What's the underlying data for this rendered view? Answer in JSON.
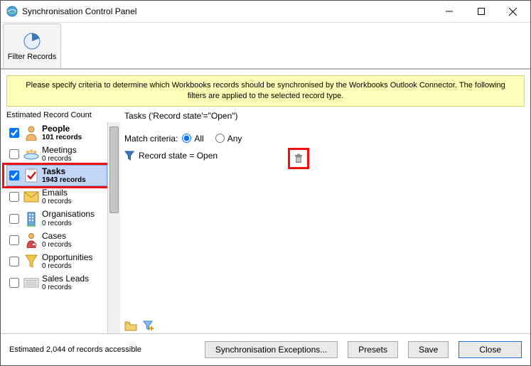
{
  "window": {
    "title": "Synchronisation Control Panel"
  },
  "ribbon": {
    "filter_records_label": "Filter Records"
  },
  "infobar": {
    "text": "Please specify criteria to determine which Workbooks records should be synchronised by the Workbooks Outlook Connector. The following filters are applied to the selected record type."
  },
  "left": {
    "header": "Estimated Record Count",
    "items": [
      {
        "key": "people",
        "name": "People",
        "count": "101 records",
        "checked": true,
        "bold": true,
        "icon": "person"
      },
      {
        "key": "meetings",
        "name": "Meetings",
        "count": "0 records",
        "checked": false,
        "bold": false,
        "icon": "meeting"
      },
      {
        "key": "tasks",
        "name": "Tasks",
        "count": "1943 records",
        "checked": true,
        "bold": true,
        "icon": "task",
        "selected": true
      },
      {
        "key": "emails",
        "name": "Emails",
        "count": "0 records",
        "checked": false,
        "bold": false,
        "icon": "email"
      },
      {
        "key": "organisations",
        "name": "Organisations",
        "count": "0 records",
        "checked": false,
        "bold": false,
        "icon": "org"
      },
      {
        "key": "cases",
        "name": "Cases",
        "count": "0 records",
        "checked": false,
        "bold": false,
        "icon": "case"
      },
      {
        "key": "opportunities",
        "name": "Opportunities",
        "count": "0 records",
        "checked": false,
        "bold": false,
        "icon": "opportunity"
      },
      {
        "key": "salesleads",
        "name": "Sales Leads",
        "count": "0 records",
        "checked": false,
        "bold": false,
        "icon": "leads"
      }
    ]
  },
  "right": {
    "header": "Tasks ('Record state'=\"Open\")",
    "match_label": "Match criteria:",
    "match_all": "All",
    "match_any": "Any",
    "match_selected": "all",
    "criteria": [
      {
        "text": "Record state = Open"
      }
    ]
  },
  "footer": {
    "estimate": "Estimated 2,044 of records accessible",
    "sync_exceptions": "Synchronisation Exceptions...",
    "presets": "Presets",
    "save": "Save",
    "close": "Close"
  }
}
